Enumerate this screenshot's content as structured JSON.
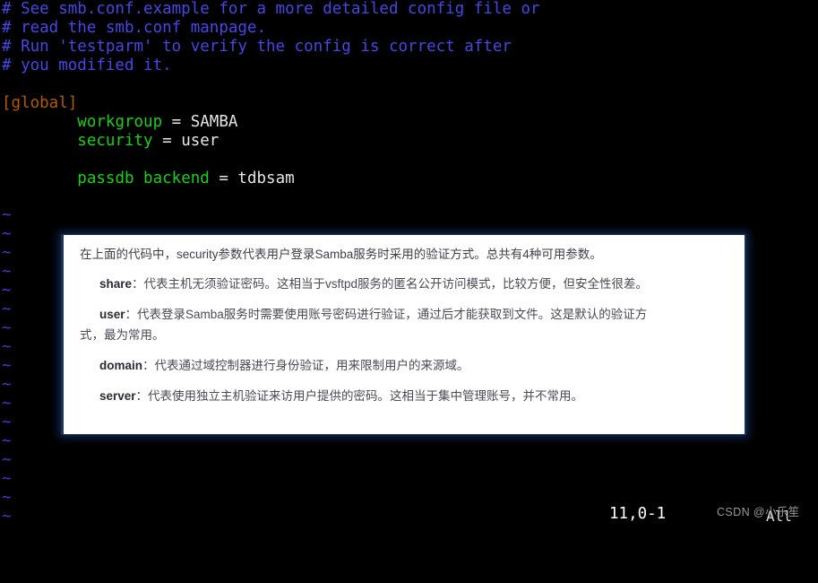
{
  "terminal": {
    "lines": [
      {
        "segments": [
          {
            "text": "# See smb.conf.example for a more detailed config file or",
            "cls": "c-comment"
          }
        ]
      },
      {
        "segments": [
          {
            "text": "# read the smb.conf manpage.",
            "cls": "c-comment"
          }
        ]
      },
      {
        "segments": [
          {
            "text": "# Run 'testparm' to verify the config is correct after",
            "cls": "c-comment"
          }
        ]
      },
      {
        "segments": [
          {
            "text": "# you modified it.",
            "cls": "c-comment"
          }
        ]
      },
      {
        "segments": [
          {
            "text": "",
            "cls": "c-plain"
          }
        ]
      },
      {
        "segments": [
          {
            "text": "[global]",
            "cls": "c-section"
          }
        ]
      },
      {
        "segments": [
          {
            "text": "        ",
            "cls": "c-plain"
          },
          {
            "text": "workgroup",
            "cls": "c-key"
          },
          {
            "text": " = ",
            "cls": "c-plain"
          },
          {
            "text": "SAMBA",
            "cls": "c-val"
          }
        ]
      },
      {
        "segments": [
          {
            "text": "        ",
            "cls": "c-plain"
          },
          {
            "text": "security",
            "cls": "c-key"
          },
          {
            "text": " = ",
            "cls": "c-plain"
          },
          {
            "text": "user",
            "cls": "c-val"
          }
        ]
      },
      {
        "segments": [
          {
            "text": "",
            "cls": "c-plain"
          }
        ]
      },
      {
        "segments": [
          {
            "text": "        ",
            "cls": "c-plain"
          },
          {
            "text": "passdb backend",
            "cls": "c-key"
          },
          {
            "text": " = ",
            "cls": "c-plain"
          },
          {
            "text": "tdbsam",
            "cls": "c-val"
          }
        ]
      }
    ],
    "tilde_glyph": "~",
    "tilde_count": 17,
    "status": {
      "position": "11,0-1",
      "percent": "All"
    },
    "colors": {
      "background": "#000000",
      "comment": "#4646e6",
      "section": "#b35900",
      "key": "#18d018",
      "value": "#e6e6e6",
      "tilde": "#3c3cdc",
      "status_text": "#ffffff"
    }
  },
  "note": {
    "intro": "在上面的代码中，security参数代表用户登录Samba服务时采用的验证方式。总共有4种可用参数。",
    "items": [
      {
        "term": "share",
        "sep": "：",
        "desc": "代表主机无须验证密码。这相当于vsftpd服务的匿名公开访问模式，比较方便，但安全性很差。",
        "wrap": ""
      },
      {
        "term": "user",
        "sep": "：",
        "desc": "代表登录Samba服务时需要使用账号密码进行验证，通过后才能获取到文件。这是默认的验证方",
        "wrap": "式，最为常用。"
      },
      {
        "term": "domain",
        "sep": "：",
        "desc": "代表通过域控制器进行身份验证，用来限制用户的来源域。",
        "wrap": ""
      },
      {
        "term": "server",
        "sep": "：",
        "desc": "代表使用独立主机验证来访用户提供的密码。这相当于集中管理账号，并不常用。",
        "wrap": ""
      }
    ],
    "colors": {
      "background": "#ffffff",
      "border": "#13325c",
      "text": "#4a4a56",
      "term": "#2b2b33",
      "glow": "#285abe"
    }
  },
  "watermark": {
    "text": "CSDN @小乐笙"
  }
}
